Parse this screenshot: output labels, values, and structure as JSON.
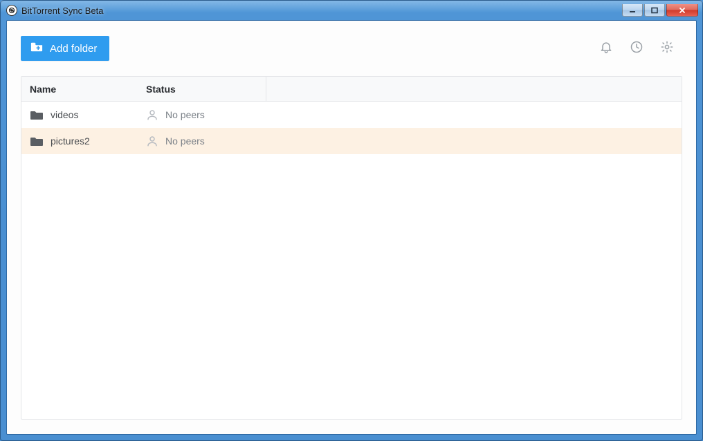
{
  "window": {
    "title": "BitTorrent Sync Beta"
  },
  "toolbar": {
    "add_folder_label": "Add folder"
  },
  "table": {
    "headers": {
      "name": "Name",
      "status": "Status"
    },
    "rows": [
      {
        "name": "videos",
        "status": "No peers",
        "highlight": false
      },
      {
        "name": "pictures2",
        "status": "No peers",
        "highlight": true
      }
    ]
  }
}
